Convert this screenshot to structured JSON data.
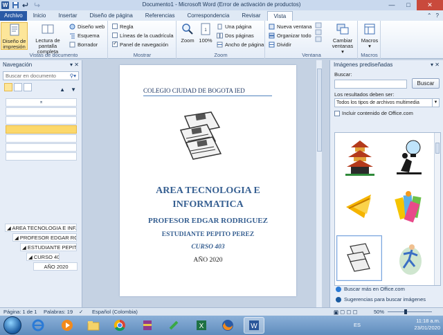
{
  "window": {
    "title": "Documento1  -  Microsoft Word (Error de activación de productos)",
    "controls": [
      "—",
      "□",
      "✕"
    ]
  },
  "tabs": [
    "Archivo",
    "Inicio",
    "Insertar",
    "Diseño de página",
    "Referencias",
    "Correspondencia",
    "Revisar",
    "Vista"
  ],
  "active_tab": "Vista",
  "ribbon": {
    "vistas_documento": {
      "label": "Vistas de documento",
      "diseno_impresion": "Diseño de impresión",
      "lectura_pantalla": "Lectura de pantalla completa",
      "diseno_web": "Diseño web",
      "esquema": "Esquema",
      "borrador": "Borrador"
    },
    "mostrar": {
      "label": "Mostrar",
      "regla": "Regla",
      "lineas_cuadricula": "Líneas de la cuadrícula",
      "panel_navegacion": "Panel de navegación",
      "panel_navegacion_checked": true
    },
    "zoom": {
      "label": "Zoom",
      "zoom": "Zoom",
      "cien": "100%",
      "una_pagina": "Una página",
      "dos_paginas": "Dos páginas",
      "ancho_pagina": "Ancho de página"
    },
    "ventana": {
      "label": "Ventana",
      "nueva_ventana": "Nueva ventana",
      "organizar_todo": "Organizar todo",
      "dividir": "Dividir",
      "cambiar_ventanas": "Cambiar ventanas"
    },
    "macros": {
      "label": "Macros",
      "macros": "Macros"
    }
  },
  "navigation": {
    "title": "Navegación",
    "search_placeholder": "Buscar en documento",
    "outline": [
      "◢ AREA TECNOLOGIA E INF...",
      "◢ PROFESOR EDGAR RO...",
      "◢ ESTUDIANTE PEPITO...",
      "◢ CURSO 403",
      "AÑO 2020"
    ]
  },
  "document": {
    "header_line": "COLEGIO CIUDAD DE BOGOTA IED",
    "title_line1": "AREA TECNOLOGIA E",
    "title_line2": "INFORMATICA",
    "profesor": "PROFESOR EDGAR RODRIGUEZ",
    "estudiante": "ESTUDIANTE PEPITO PEREZ",
    "curso": "CURSO 403",
    "anio": "AÑO 2020"
  },
  "clipart": {
    "title": "Imágenes prediseñadas",
    "buscar_label": "Buscar:",
    "buscar_button": "Buscar",
    "resultados_label": "Los resultados deben ser:",
    "resultados_value": "Todos los tipos de archivos multimedia",
    "incluir_label": "Incluir contenido de Office.com",
    "link_mas": "Buscar más en Office.com",
    "link_sugerencias": "Sugerencias para buscar imágenes"
  },
  "status": {
    "pagina": "Página: 1 de 1",
    "palabras": "Palabras: 19",
    "idioma": "Español (Colombia)",
    "zoom": "50%"
  },
  "taskbar": {
    "lang": "ES",
    "time": "11:18 a.m.",
    "date": "23/01/2020"
  },
  "colors": {
    "accent": "#2a5aa6",
    "title_blue": "#365f91",
    "selection": "#fcd86b"
  }
}
